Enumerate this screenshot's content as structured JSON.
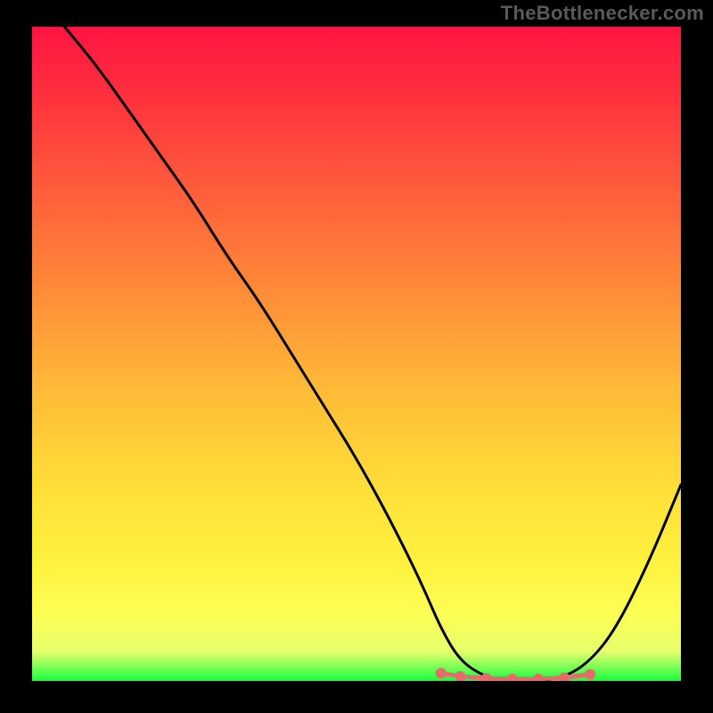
{
  "attribution": "TheBottlenecker.com",
  "colors": {
    "top_gradient": "#ff183f",
    "mid1_gradient": "#ff7d3a",
    "mid2_gradient": "#ffe63b",
    "bottom_band_yellow": "#fbff6e",
    "bottom_band_green": "#1dfd46",
    "curve_stroke": "#000000",
    "marker_fill": "#e86b6b",
    "frame_bg": "#000000",
    "attribution_text": "#5a5a5a"
  },
  "chart_data": {
    "type": "line",
    "title": "",
    "xlabel": "",
    "ylabel": "",
    "xlim": [
      0,
      100
    ],
    "ylim": [
      0,
      100
    ],
    "x": [
      5,
      10,
      15,
      20,
      25,
      30,
      35,
      40,
      45,
      50,
      55,
      60,
      63,
      66,
      70,
      74,
      78,
      82,
      86,
      90,
      95,
      100
    ],
    "values": [
      100,
      94,
      87,
      80,
      73,
      65,
      58,
      50,
      42,
      34,
      25,
      15,
      8,
      3,
      0.5,
      0,
      0,
      0.5,
      3,
      8,
      18,
      30
    ],
    "optimum_region": {
      "x_start": 63,
      "x_end": 86,
      "markers_x": [
        63,
        66,
        70,
        74,
        78,
        82,
        86
      ],
      "markers_y": [
        1.2,
        0.7,
        0.4,
        0.3,
        0.3,
        0.5,
        1.0
      ]
    }
  }
}
